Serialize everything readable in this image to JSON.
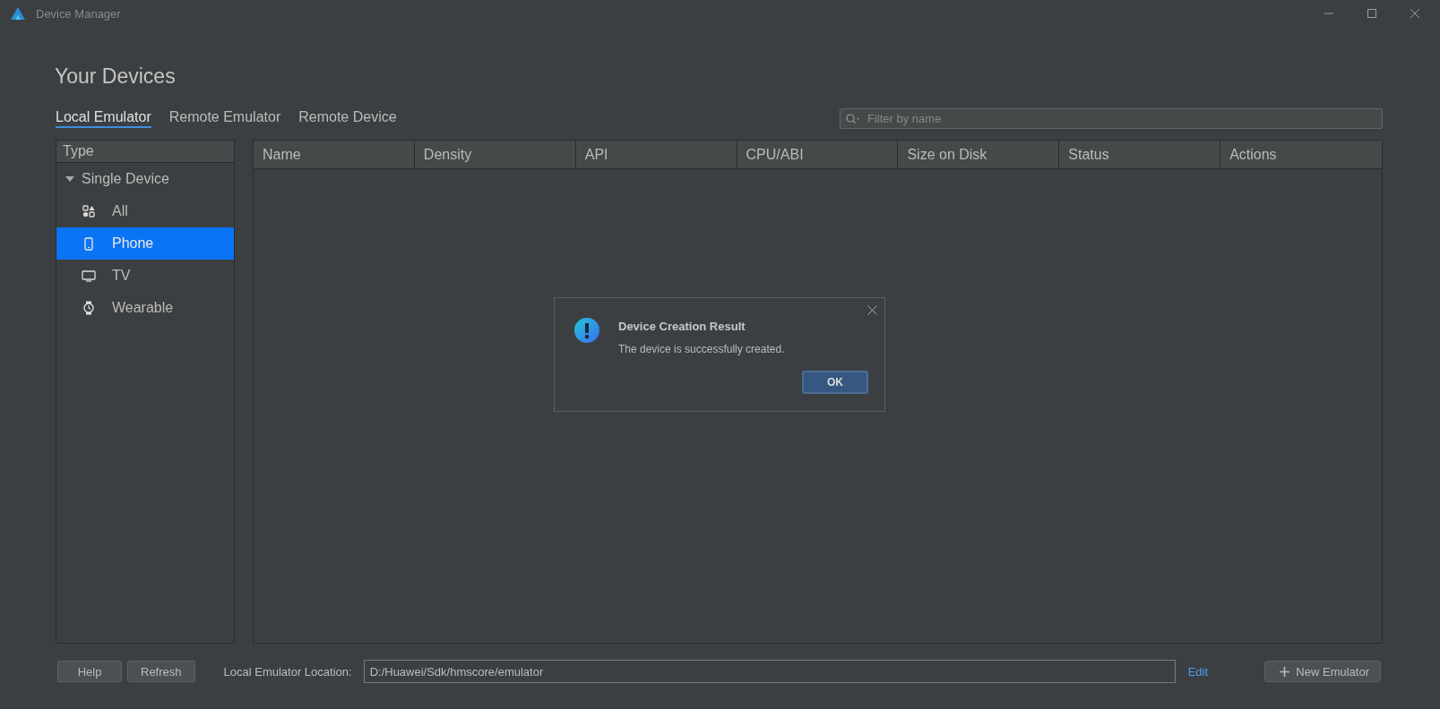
{
  "window": {
    "title": "Device Manager"
  },
  "heading": "Your Devices",
  "tabs": [
    {
      "label": "Local Emulator",
      "selected": true
    },
    {
      "label": "Remote Emulator",
      "selected": false
    },
    {
      "label": "Remote Device",
      "selected": false
    }
  ],
  "search": {
    "placeholder": "Filter by name"
  },
  "sidebar": {
    "header": "Type",
    "items": [
      {
        "label": "Single Device",
        "expanded": true,
        "children": [
          {
            "label": "All",
            "kind": "all",
            "selected": false
          },
          {
            "label": "Phone",
            "kind": "phone",
            "selected": true
          },
          {
            "label": "TV",
            "kind": "tv",
            "selected": false
          },
          {
            "label": "Wearable",
            "kind": "watch",
            "selected": false
          }
        ]
      }
    ]
  },
  "table": {
    "columns": [
      "Name",
      "Density",
      "API",
      "CPU/ABI",
      "Size on Disk",
      "Status",
      "Actions"
    ]
  },
  "dialog": {
    "title": "Device Creation Result",
    "message": "The device is successfully created.",
    "button": "OK"
  },
  "footer": {
    "buttons": [
      "Help",
      "Refresh"
    ],
    "location_label": "Local Emulator Location:",
    "location_value": "D:/Huawei/Sdk/hmscore/emulator",
    "edit_link": "Edit",
    "new_button": "New Emulator"
  }
}
